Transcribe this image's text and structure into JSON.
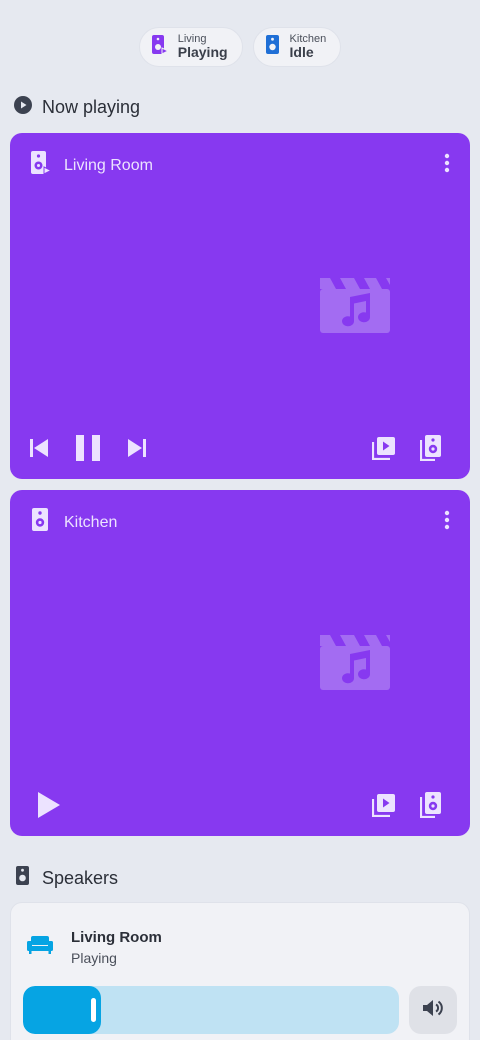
{
  "chips": [
    {
      "name": "Living",
      "state": "Playing",
      "icon": "speaker-playing-icon",
      "color": "#8739f0"
    },
    {
      "name": "Kitchen",
      "state": "Idle",
      "icon": "speaker-icon",
      "color": "#1f6fd6"
    }
  ],
  "now_playing": {
    "title": "Now playing",
    "cards": [
      {
        "name": "Living Room",
        "state": "playing"
      },
      {
        "name": "Kitchen",
        "state": "idle"
      }
    ]
  },
  "speakers": {
    "title": "Speakers",
    "items": [
      {
        "name": "Living Room",
        "state": "Playing",
        "volume_percent": 18
      }
    ]
  },
  "colors": {
    "card": "#8739f0",
    "accent": "#06a4e3",
    "background": "#e6e9f0"
  }
}
